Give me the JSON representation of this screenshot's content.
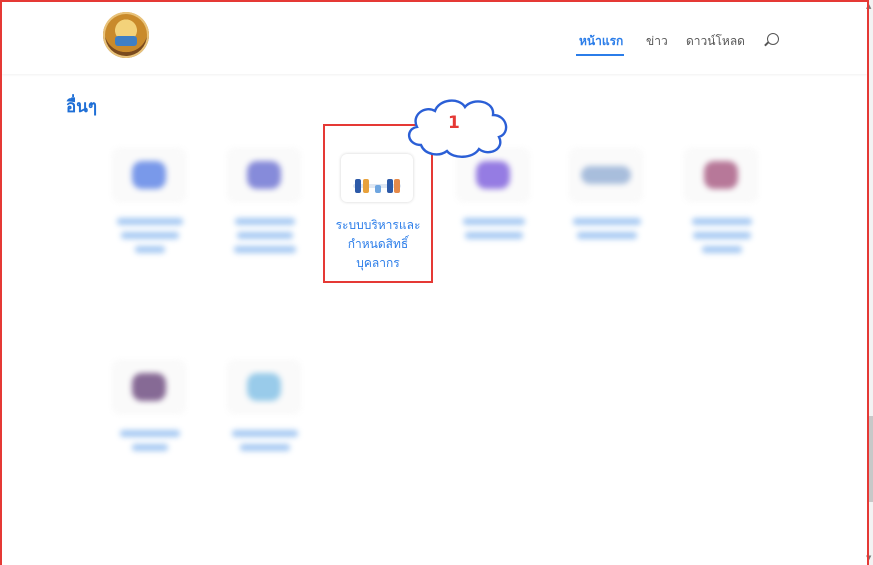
{
  "nav": {
    "home": "หน้าแรก",
    "news": "ข่าว",
    "download": "ดาวน์โหลด"
  },
  "section": {
    "title": "อื่นๆ"
  },
  "featured_card": {
    "label_line1": "ระบบบริหารและ",
    "label_line2": "กำหนดสิทธิ์",
    "label_line3": "บุคลากร"
  },
  "annotation": {
    "number": "1"
  },
  "colors": {
    "accent": "#2b7de9",
    "highlight": "#e53935"
  },
  "icons": [
    "logo-icon",
    "search-icon",
    "staff-illustration-icon",
    "cloud-callout-icon"
  ]
}
